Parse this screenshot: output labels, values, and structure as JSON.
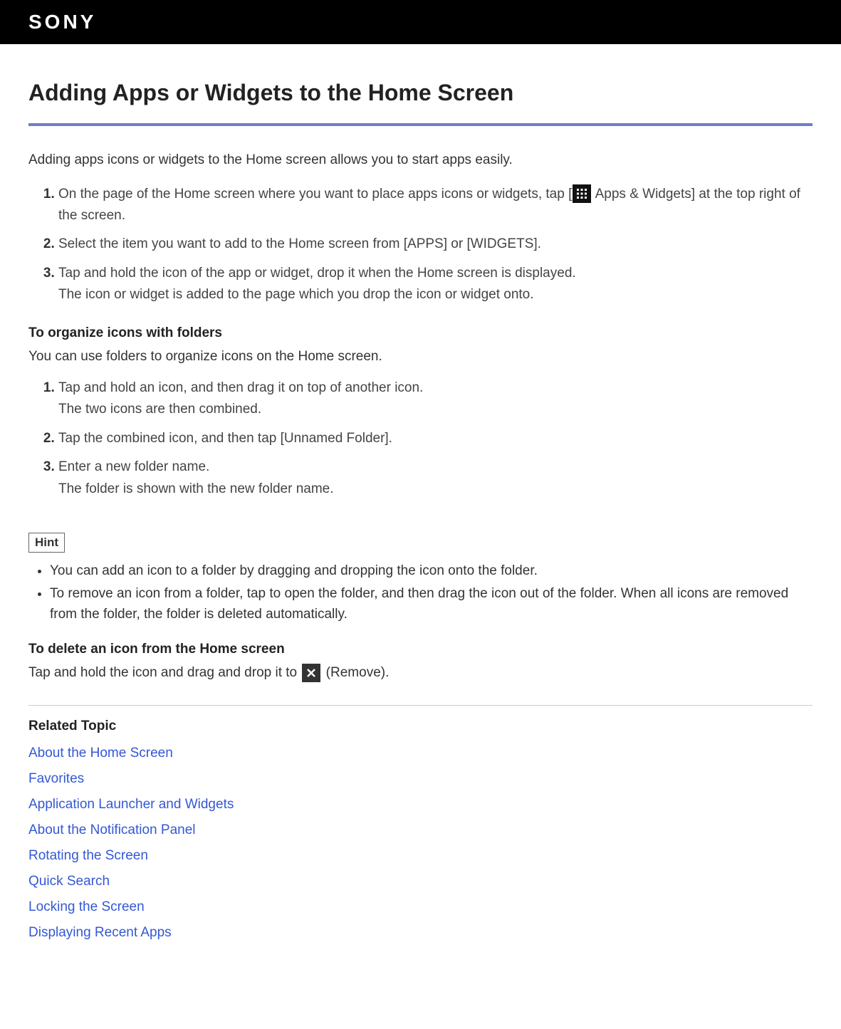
{
  "logo": "SONY",
  "title": "Adding Apps or Widgets to the Home Screen",
  "intro": "Adding apps icons or widgets to the Home screen allows you to start apps easily.",
  "steps1": {
    "s1a": "On the page of the Home screen where you want to place apps icons or widgets, tap [",
    "s1b": " Apps & Widgets] at the top right of the screen.",
    "s2": "Select the item you want to add to the Home screen from [APPS] or [WIDGETS].",
    "s3a": "Tap and hold the icon of the app or widget, drop it when the Home screen is displayed.",
    "s3b": "The icon or widget is added to the page which you drop the icon or widget onto."
  },
  "organize": {
    "heading": "To organize icons with folders",
    "text": "You can use folders to organize icons on the Home screen.",
    "s1a": "Tap and hold an icon, and then drag it on top of another icon.",
    "s1b": "The two icons are then combined.",
    "s2": "Tap the combined icon, and then tap [Unnamed Folder].",
    "s3a": "Enter a new folder name.",
    "s3b": "The folder is shown with the new folder name."
  },
  "hint": {
    "label": "Hint",
    "h1": "You can add an icon to a folder by dragging and dropping the icon onto the folder.",
    "h2": "To remove an icon from a folder, tap to open the folder, and then drag the icon out of the folder. When all icons are removed from the folder, the folder is deleted automatically."
  },
  "delete": {
    "heading": "To delete an icon from the Home screen",
    "t1": "Tap and hold the icon and drag and drop it to ",
    "t2": " (Remove)."
  },
  "related": {
    "heading": "Related Topic",
    "links": {
      "l0": "About the Home Screen",
      "l1": "Favorites",
      "l2": "Application Launcher and Widgets",
      "l3": "About the Notification Panel",
      "l4": "Rotating the Screen",
      "l5": "Quick Search",
      "l6": "Locking the Screen",
      "l7": "Displaying Recent Apps"
    }
  }
}
